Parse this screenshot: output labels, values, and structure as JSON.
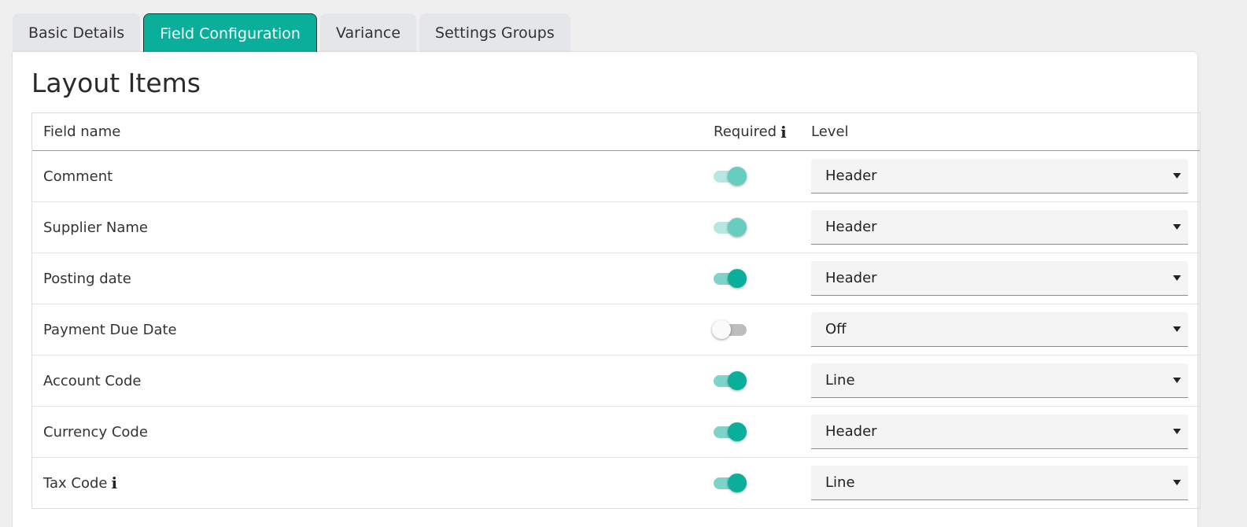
{
  "tabs": [
    {
      "label": "Basic Details",
      "active": false
    },
    {
      "label": "Field Configuration",
      "active": true
    },
    {
      "label": "Variance",
      "active": false
    },
    {
      "label": "Settings Groups",
      "active": false
    }
  ],
  "section": {
    "title": "Layout Items"
  },
  "table": {
    "headers": {
      "field_name": "Field name",
      "required": "Required",
      "level": "Level"
    },
    "rows": [
      {
        "field": "Comment",
        "info": false,
        "required": "on-disabled",
        "level": "Header"
      },
      {
        "field": "Supplier Name",
        "info": false,
        "required": "on-disabled",
        "level": "Header"
      },
      {
        "field": "Posting date",
        "info": false,
        "required": "on",
        "level": "Header"
      },
      {
        "field": "Payment Due Date",
        "info": false,
        "required": "off",
        "level": "Off"
      },
      {
        "field": "Account Code",
        "info": false,
        "required": "on",
        "level": "Line"
      },
      {
        "field": "Currency Code",
        "info": false,
        "required": "on",
        "level": "Header"
      },
      {
        "field": "Tax Code",
        "info": true,
        "required": "on",
        "level": "Line"
      }
    ]
  },
  "icons": {
    "info": "info-icon",
    "dropdown": "caret-down-icon"
  },
  "colors": {
    "accent": "#0aaf9c",
    "toggle_track_on": "#7fd4ca",
    "toggle_off_track": "#bdbdbd",
    "page_background": "#efefef"
  }
}
